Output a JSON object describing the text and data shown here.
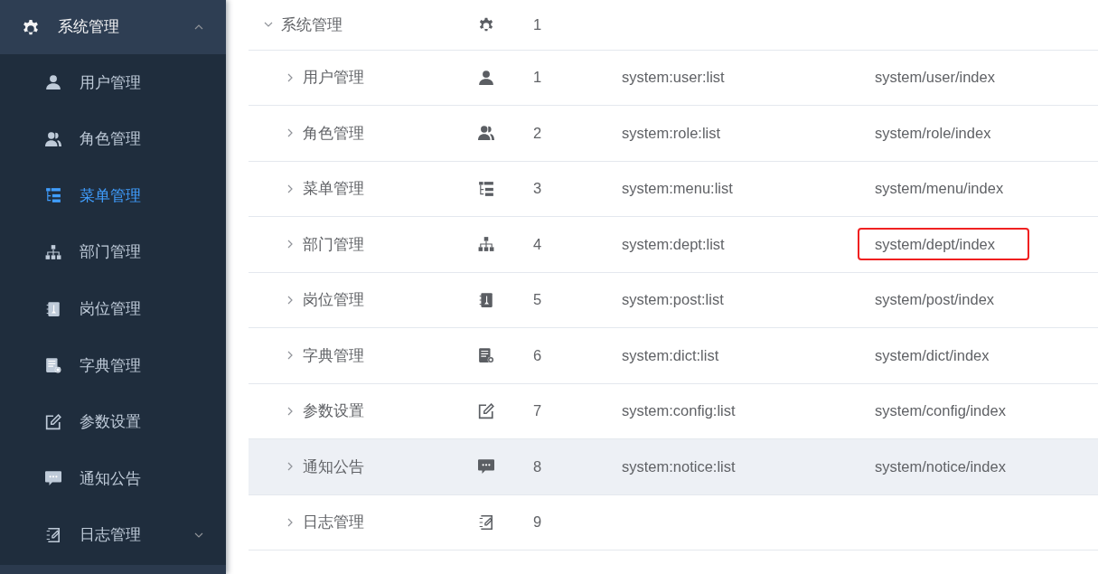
{
  "sidebar": {
    "label": "系统管理",
    "expanded": true,
    "children": [
      {
        "label": "用户管理",
        "kind": "item",
        "selected": false
      },
      {
        "label": "角色管理",
        "kind": "item",
        "selected": false
      },
      {
        "label": "菜单管理",
        "kind": "item",
        "selected": true
      },
      {
        "label": "部门管理",
        "kind": "item",
        "selected": false
      },
      {
        "label": "岗位管理",
        "kind": "item",
        "selected": false
      },
      {
        "label": "字典管理",
        "kind": "item",
        "selected": false
      },
      {
        "label": "参数设置",
        "kind": "item",
        "selected": false
      },
      {
        "label": "通知公告",
        "kind": "item",
        "selected": false
      },
      {
        "label": "日志管理",
        "kind": "submenu",
        "expanded": false,
        "selected": false
      }
    ]
  },
  "menu_table": {
    "rows": [
      {
        "name": "系统管理",
        "expanded": true,
        "order": "1",
        "children": [
          {
            "name": "用户管理",
            "expanded": false,
            "order": "1",
            "perms": "system:user:list",
            "component": "system/user/index"
          },
          {
            "name": "角色管理",
            "expanded": false,
            "order": "2",
            "perms": "system:role:list",
            "component": "system/role/index"
          },
          {
            "name": "菜单管理",
            "expanded": false,
            "order": "3",
            "perms": "system:menu:list",
            "component": "system/menu/index"
          },
          {
            "name": "部门管理",
            "expanded": false,
            "order": "4",
            "perms": "system:dept:list",
            "component": "system/dept/index",
            "marked": true
          },
          {
            "name": "岗位管理",
            "expanded": false,
            "order": "5",
            "perms": "system:post:list",
            "component": "system/post/index"
          },
          {
            "name": "字典管理",
            "expanded": false,
            "order": "6",
            "perms": "system:dict:list",
            "component": "system/dict/index"
          },
          {
            "name": "参数设置",
            "expanded": false,
            "order": "7",
            "perms": "system:config:list",
            "component": "system/config/index"
          },
          {
            "name": "通知公告",
            "expanded": false,
            "order": "8",
            "perms": "system:notice:list",
            "component": "system/notice/index",
            "hovered": true
          },
          {
            "name": "日志管理",
            "expanded": false,
            "order": "9"
          }
        ]
      }
    ]
  }
}
